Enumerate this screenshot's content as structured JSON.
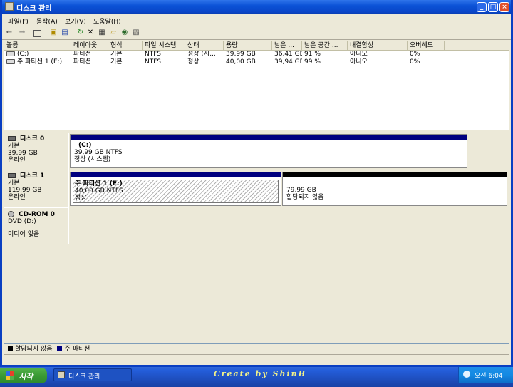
{
  "window": {
    "title": "디스크 관리"
  },
  "menubar": [
    "파일(F)",
    "동작(A)",
    "보기(V)",
    "도움말(H)"
  ],
  "toolbar": {
    "icons": [
      "back-arrow-icon",
      "forward-arrow-icon",
      "console-tree-icon",
      "properties-icon",
      "help-icon",
      "refresh-icon",
      "delete-icon",
      "settings-icon",
      "open-icon",
      "search-icon",
      "export-icon"
    ]
  },
  "volume_list": {
    "columns": [
      "볼륨",
      "레이아웃",
      "형식",
      "파일 시스템",
      "상태",
      "용량",
      "남은 ...",
      "남은 공간 ...",
      "내결함성",
      "오버헤드"
    ],
    "rows": [
      [
        "(C:)",
        "파티션",
        "기본",
        "NTFS",
        "정상 (시...",
        "39,99 GB",
        "36,41 GB",
        "91 %",
        "아니오",
        "0%"
      ],
      [
        "주 파티션 1 (E:)",
        "파티션",
        "기본",
        "NTFS",
        "정상",
        "40,00 GB",
        "39,94 GB",
        "99 %",
        "아니오",
        "0%"
      ]
    ]
  },
  "disks": {
    "disk0": {
      "name": "디스크 0",
      "type": "기본",
      "size": "39,99 GB",
      "status": "온라인",
      "partition": {
        "name": "(C:)",
        "size": "39,99 GB NTFS",
        "status": "정상 (시스템)"
      }
    },
    "disk1": {
      "name": "디스크 1",
      "type": "기본",
      "size": "119,99 GB",
      "status": "온라인",
      "partition": {
        "name": "주 파티션 1  (E:)",
        "size": "40,00 GB NTFS",
        "status": "정상"
      },
      "unallocated": {
        "size": "79,99 GB",
        "label": "할당되지 않음"
      }
    },
    "cdrom0": {
      "name": "CD-ROM 0",
      "drive": "DVD (D:)",
      "status": "미디어 없음"
    }
  },
  "legend": {
    "unallocated": "할당되지 않음",
    "primary": "주 파티션"
  },
  "colors": {
    "primary_partition": "#000080",
    "unallocated": "#000000",
    "title_bar": "#0a46c8",
    "start_button": "#3a9a34"
  },
  "taskbar": {
    "start": "시작",
    "task": "디스크 관리",
    "watermark": "Create by ShinB",
    "clock": "오전 6:04"
  }
}
